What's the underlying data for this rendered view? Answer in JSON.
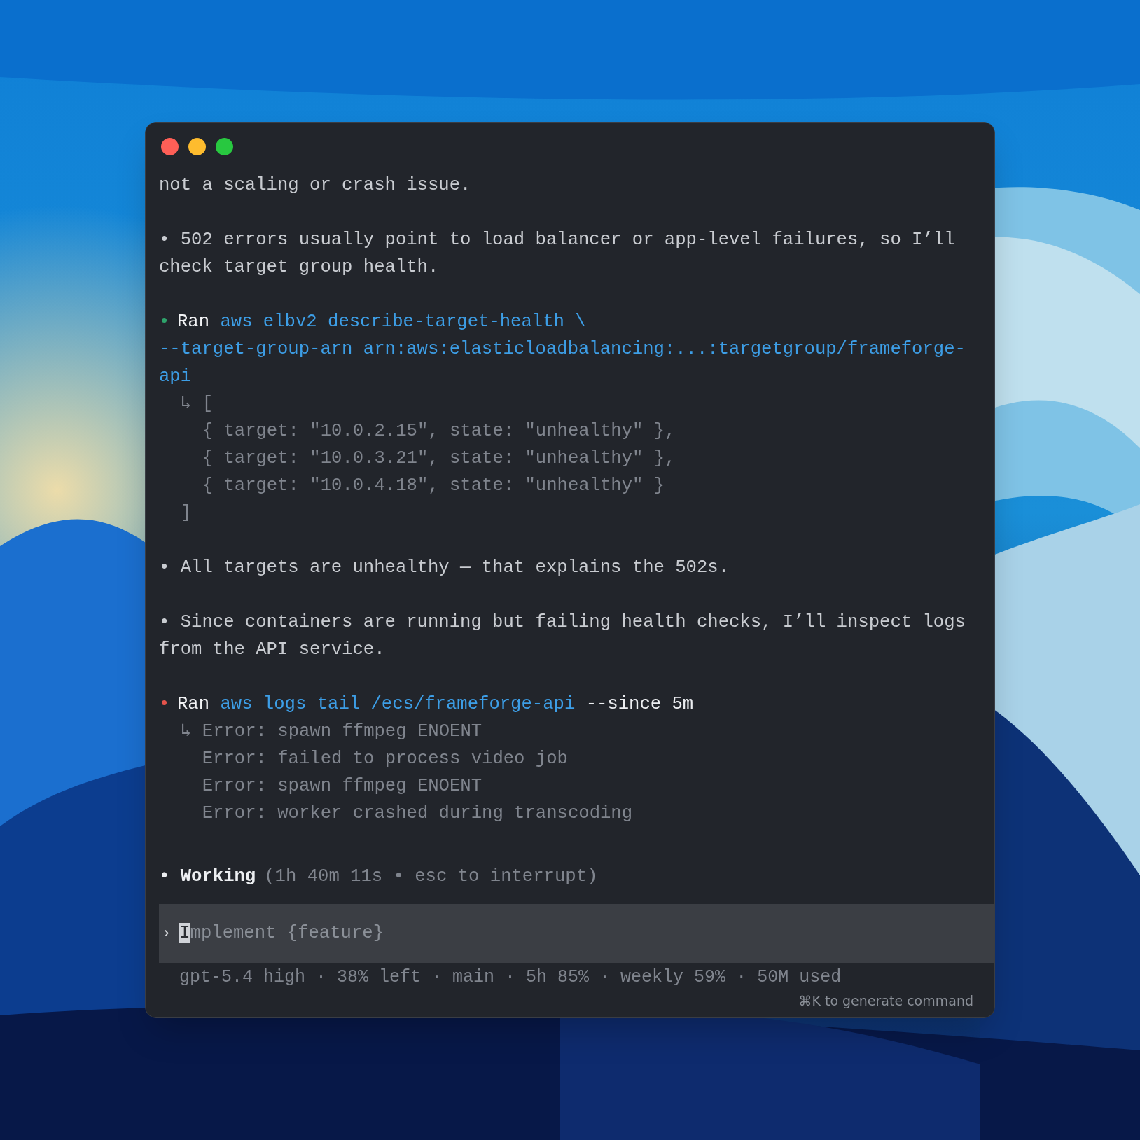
{
  "window": {
    "controls": [
      {
        "color": "#fe5f57"
      },
      {
        "color": "#febc2e"
      },
      {
        "color": "#28c840"
      }
    ]
  },
  "transcript": [
    {
      "kind": "message",
      "text": "not a scaling or crash issue."
    },
    {
      "kind": "message",
      "text": "• 502 errors usually point to load balancer or app-level failures, so I’ll check target group health."
    },
    {
      "kind": "command",
      "label": "Ran",
      "color": "#2ea36b",
      "command": [
        "aws elbv2 describe-target-health \\",
        "--target-group-arn arn:aws:elasticloadbalancing:...:targetgroup/frameforge-api"
      ],
      "output": [
        "↳ [",
        "  { target: \"10.0.2.15\", state: \"unhealthy\" },",
        "  { target: \"10.0.3.21\", state: \"unhealthy\" },",
        "  { target: \"10.0.4.18\", state: \"unhealthy\" }",
        "]"
      ]
    },
    {
      "kind": "message",
      "text": "• All targets are unhealthy — that explains the 502s."
    },
    {
      "kind": "message",
      "text": "• Since containers are running but failing health checks, I’ll inspect logs from the API service."
    },
    {
      "kind": "command",
      "label": "Ran",
      "color": "#e5534b",
      "command": [
        "aws logs tail /ecs/frameforge-api"
      ],
      "args": "--since 5m",
      "output": [
        "↳ Error: spawn ffmpeg ENOENT",
        "  Error: failed to process video job",
        "  Error: spawn ffmpeg ENOENT",
        "  Error: worker crashed during transcoding"
      ]
    }
  ],
  "status": {
    "label": "• Working",
    "detail": "(1h 40m 11s • esc to interrupt)"
  },
  "composer": {
    "prompt": "›",
    "placeholder": "Implement {feature}"
  },
  "footer": {
    "info": "gpt-5.4 high · 38% left · main · 5h 85% · weekly 59% · 50M used",
    "hint": "⌘K to generate command"
  }
}
